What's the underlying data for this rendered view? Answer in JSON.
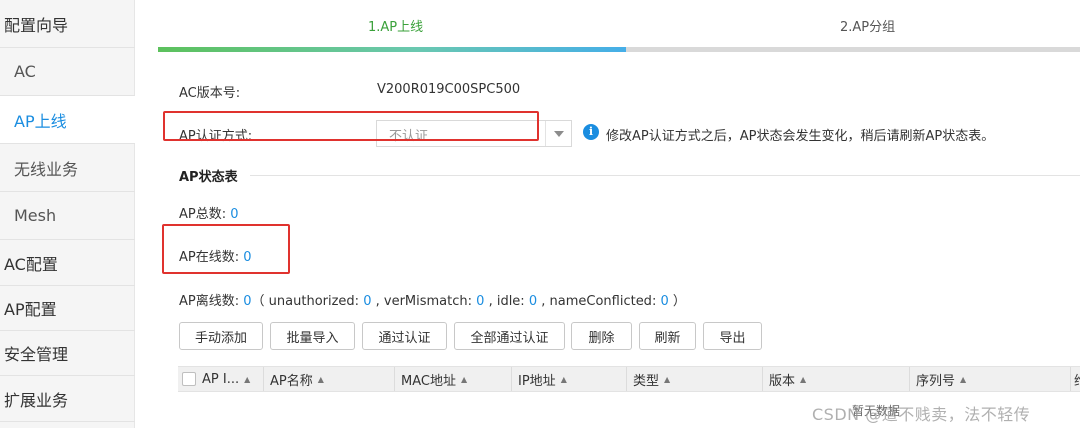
{
  "sidebar": {
    "items": [
      {
        "label": "配置向导",
        "level": "top",
        "active": false
      },
      {
        "label": "AC",
        "level": "sub",
        "active": false
      },
      {
        "label": "AP上线",
        "level": "sub",
        "active": true
      },
      {
        "label": "无线业务",
        "level": "sub",
        "active": false
      },
      {
        "label": "Mesh",
        "level": "sub",
        "active": false
      },
      {
        "label": "AC配置",
        "level": "top",
        "active": false
      },
      {
        "label": "AP配置",
        "level": "top",
        "active": false
      },
      {
        "label": "安全管理",
        "level": "top",
        "active": false
      },
      {
        "label": "扩展业务",
        "level": "top",
        "active": false
      }
    ]
  },
  "wizard": {
    "steps": [
      "1.AP上线",
      "2.AP分组"
    ],
    "active_step": 1,
    "progress": 0.508
  },
  "form": {
    "ac_version_label": "AC版本号:",
    "ac_version_value": "V200R019C00SPC500",
    "auth_label": "AP认证方式:",
    "auth_value": "不认证",
    "auth_hint": "修改AP认证方式之后，AP状态会发生变化，稍后请刷新AP状态表。"
  },
  "status": {
    "title": "AP状态表",
    "total_label": "AP总数:",
    "total_value": "0",
    "online_label": "AP在线数:",
    "online_value": "0",
    "offline_label": "AP离线数:",
    "offline_value": "0",
    "offline_detail": [
      {
        "prefix": "（ unauthorized: ",
        "value": "0"
      },
      {
        "prefix": " , verMismatch: ",
        "value": "0"
      },
      {
        "prefix": " , idle: ",
        "value": "0"
      },
      {
        "prefix": " , nameConflicted: ",
        "value": "0"
      }
    ],
    "offline_close": " ）"
  },
  "toolbar": {
    "buttons": [
      "手动添加",
      "批量导入",
      "通过认证",
      "全部通过认证",
      "删除",
      "刷新",
      "导出"
    ]
  },
  "table": {
    "columns": [
      "AP I...",
      "AP名称",
      "MAC地址",
      "IP地址",
      "类型",
      "版本",
      "序列号",
      "维"
    ],
    "empty_text": "暂无数据"
  },
  "watermark": "CSDN @道不贱卖，法不轻传",
  "colors": {
    "accent_blue": "#1a8de0",
    "step_green": "#3aa13a",
    "highlight_red": "#e0322e"
  }
}
